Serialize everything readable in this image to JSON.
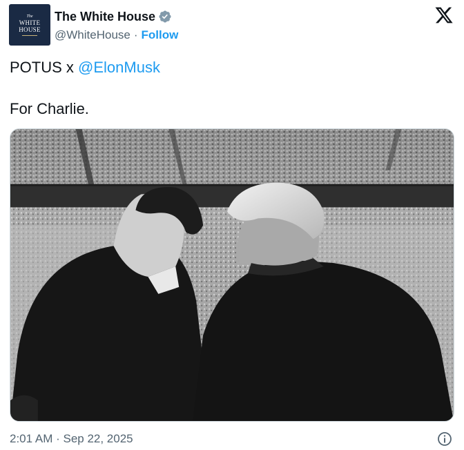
{
  "author": {
    "display_name": "The White House",
    "handle": "@WhiteHouse",
    "separator": "·",
    "follow_label": "Follow",
    "avatar_text": {
      "line1": "The",
      "line2": "WHITE",
      "line3": "HOUSE"
    }
  },
  "post": {
    "line1_prefix": "POTUS x ",
    "mention": "@ElonMusk",
    "line2": "For Charlie."
  },
  "meta": {
    "timestamp": "2:01 AM · Sep 22, 2025"
  },
  "icons": {
    "verified": "verified-badge-icon",
    "platform": "x-logo-icon",
    "info": "info-icon"
  },
  "colors": {
    "accent": "#1d9bf0",
    "text": "#0f1419",
    "secondary": "#536471",
    "verified_badge": "#829aab"
  }
}
